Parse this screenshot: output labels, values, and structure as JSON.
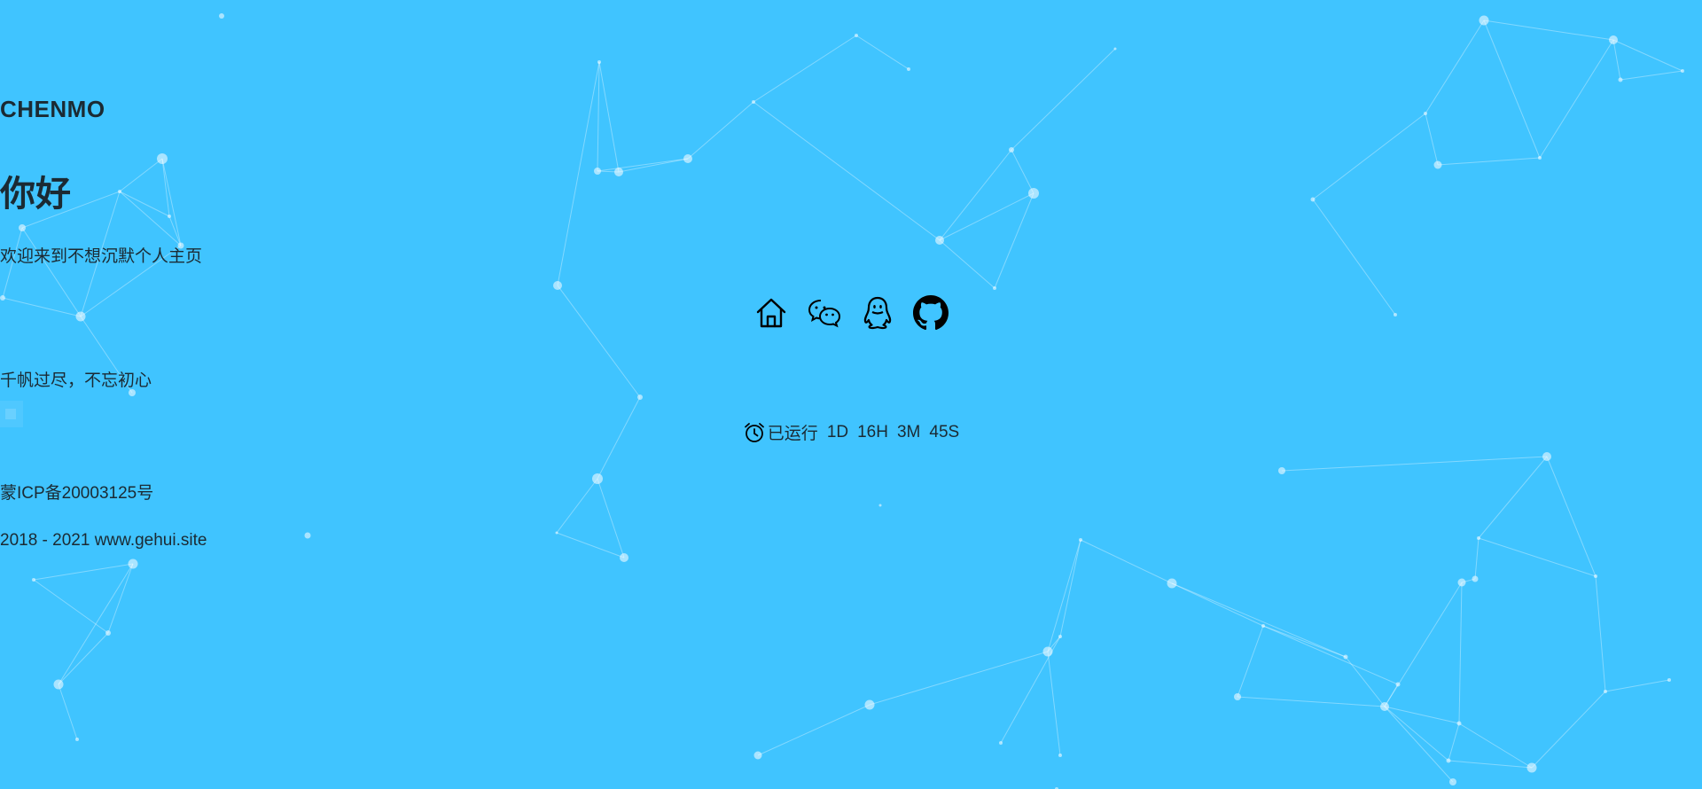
{
  "header": {
    "brand": "CHENMO"
  },
  "hero": {
    "greeting": "你好",
    "welcome": "欢迎来到不想沉默个人主页"
  },
  "social": {
    "items": [
      {
        "name": "home",
        "icon": "home-icon"
      },
      {
        "name": "wechat",
        "icon": "wechat-icon"
      },
      {
        "name": "qq",
        "icon": "qq-icon"
      },
      {
        "name": "github",
        "icon": "github-icon"
      }
    ]
  },
  "motto": "千帆过尽，不忘初心",
  "uptime": {
    "label": "已运行",
    "days": "1D",
    "hours": "16H",
    "minutes": "3M",
    "seconds": "45S",
    "icon": "alarm-clock-icon"
  },
  "footer": {
    "icp": "蒙ICP备20003125号",
    "copyright": "2018 - 2021 www.gehui.site"
  },
  "colors": {
    "background": "#40c4ff",
    "text": "#1b2a33",
    "particles": "#ffffff"
  }
}
